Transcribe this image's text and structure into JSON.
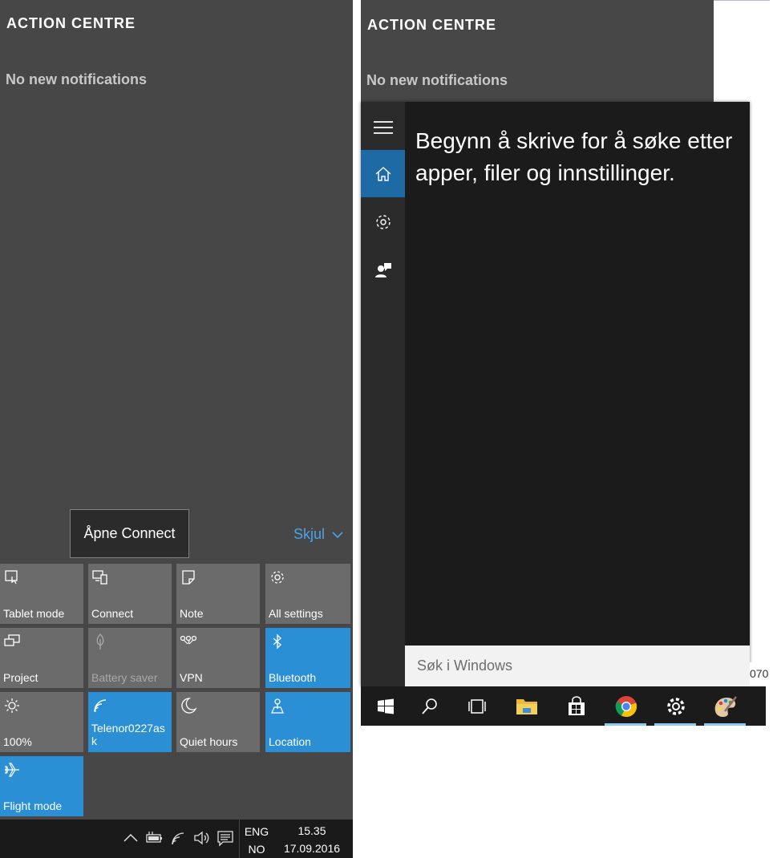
{
  "left_panel": {
    "title": "ACTION CENTRE",
    "empty_text": "No new notifications",
    "tooltip": "Åpne Connect",
    "collapse_label": "Skjul",
    "tiles": [
      {
        "label": "Tablet mode",
        "icon": "tablet-mode-icon",
        "state": "off"
      },
      {
        "label": "Connect",
        "icon": "connect-icon",
        "state": "off"
      },
      {
        "label": "Note",
        "icon": "note-icon",
        "state": "off"
      },
      {
        "label": "All settings",
        "icon": "gear-icon",
        "state": "off"
      },
      {
        "label": "Project",
        "icon": "project-icon",
        "state": "off"
      },
      {
        "label": "Battery saver",
        "icon": "battery-saver-icon",
        "state": "disabled"
      },
      {
        "label": "VPN",
        "icon": "vpn-icon",
        "state": "off"
      },
      {
        "label": "Bluetooth",
        "icon": "bluetooth-icon",
        "state": "on"
      },
      {
        "label": "100%",
        "icon": "brightness-icon",
        "state": "off"
      },
      {
        "label": "Telenor0227ask",
        "icon": "wifi-icon",
        "state": "on"
      },
      {
        "label": "Quiet hours",
        "icon": "moon-icon",
        "state": "off"
      },
      {
        "label": "Location",
        "icon": "location-icon",
        "state": "on"
      },
      {
        "label": "Flight mode",
        "icon": "airplane-icon",
        "state": "on"
      }
    ],
    "taskbar": {
      "language_top": "ENG",
      "language_bottom": "NO",
      "time": "15.35",
      "date": "17.09.2016"
    }
  },
  "right_panel": {
    "title": "ACTION CENTRE",
    "empty_text": "No new notifications",
    "search_hint": "Begynn å skrive for å søke etter apper, filer og innstillinger.",
    "search_placeholder": "Søk i Windows",
    "edge_text": "070",
    "rail_items": [
      "hamburger-icon",
      "home-icon",
      "gear-icon",
      "feedback-icon"
    ],
    "taskbar_items": [
      "windows-start-icon",
      "search-icon",
      "task-view-icon",
      "file-explorer-icon",
      "store-icon",
      "chrome-icon",
      "settings-icon",
      "paint-icon"
    ]
  },
  "colors": {
    "accent": "#2b8fd6",
    "panel": "#474747",
    "tile_off": "#6b6b6b",
    "search_bg": "#1b1b1b",
    "rail_active": "#1e6aa5"
  }
}
